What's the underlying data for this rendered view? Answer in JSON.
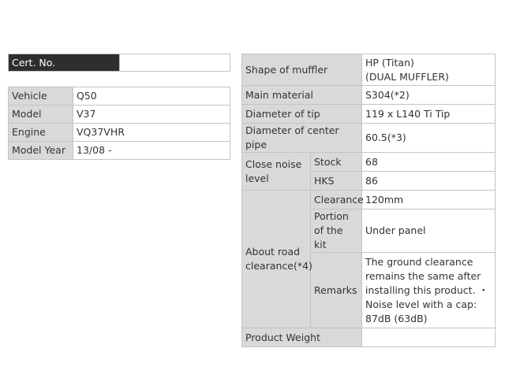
{
  "cert": {
    "label": "Cert. No.",
    "value": ""
  },
  "vehicle_table": [
    {
      "label": "Vehicle",
      "value": "Q50"
    },
    {
      "label": "Model",
      "value": "V37"
    },
    {
      "label": "Engine",
      "value": "VQ37VHR"
    },
    {
      "label": "Model Year",
      "value": "13/08 -"
    }
  ],
  "specs": {
    "shape_of_muffler": {
      "label": "Shape of muffler",
      "value_line1": "HP (Titan)",
      "value_line2": "(DUAL MUFFLER)"
    },
    "main_material": {
      "label": "Main material",
      "value": "S304(*2)"
    },
    "diameter_of_tip": {
      "label": "Diameter of tip",
      "value": "119 x L140 Ti Tip"
    },
    "diameter_of_center_pipe": {
      "label": "Diameter of center pipe",
      "value": "60.5(*3)"
    },
    "close_noise_level": {
      "label": "Close noise level",
      "stock_label": "Stock",
      "stock_value": "68",
      "hks_label": "HKS",
      "hks_value": "86"
    },
    "about_road_clearance": {
      "label": "About road clearance(*4)",
      "clearance_label": "Clearance",
      "clearance_value": "120mm",
      "portion_label": "Portion of the kit",
      "portion_value": "Under panel",
      "remarks_label": "Remarks",
      "remarks_value": "The ground clearance remains the same after installing this product. ・Noise level with a cap: 87dB (63dB)"
    },
    "product_weight": {
      "label": "Product Weight",
      "value": ""
    }
  }
}
